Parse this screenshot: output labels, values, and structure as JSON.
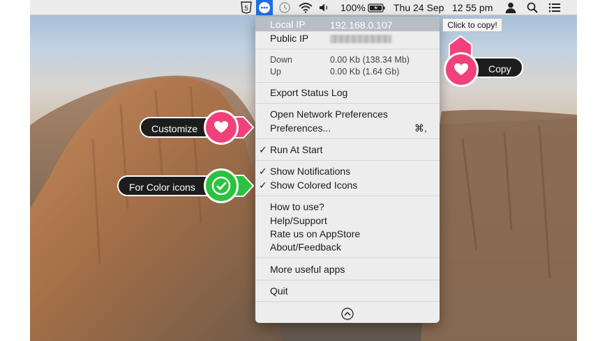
{
  "menubar": {
    "battery_percent": "100%",
    "date": "Thu 24 Sep",
    "time": "12 55 pm",
    "icons": [
      "html5-icon",
      "network-status-icon",
      "time-machine-icon",
      "wifi-icon",
      "volume-icon",
      "battery-icon",
      "user-icon",
      "spotlight-search-icon",
      "notification-list-icon"
    ]
  },
  "menu": {
    "local_ip_label": "Local IP",
    "local_ip_value": "192.168.0.107",
    "public_ip_label": "Public IP",
    "down_label": "Down",
    "down_value": "0.00 Kb (138.34 Mb)",
    "up_label": "Up",
    "up_value": "0.00 Kb (1.64 Gb)",
    "export_log": "Export Status Log",
    "open_network_prefs": "Open Network Preferences",
    "preferences": "Preferences...",
    "preferences_shortcut": "⌘,",
    "run_at_start": "Run At Start",
    "show_notifications": "Show Notifications",
    "show_colored_icons": "Show Colored Icons",
    "how_to_use": "How to use?",
    "help_support": "Help/Support",
    "rate_us": "Rate us on AppStore",
    "about_feedback": "About/Feedback",
    "more_apps": "More useful apps",
    "quit": "Quit"
  },
  "callouts": {
    "tooltip": "Click to copy!",
    "copy": "Copy",
    "customize": "Customize",
    "color_icons": "For Color icons"
  },
  "colors": {
    "pink_accent": "#f0417a",
    "green_accent": "#2bc23f",
    "menubar_highlight": "#1f6fe0"
  }
}
